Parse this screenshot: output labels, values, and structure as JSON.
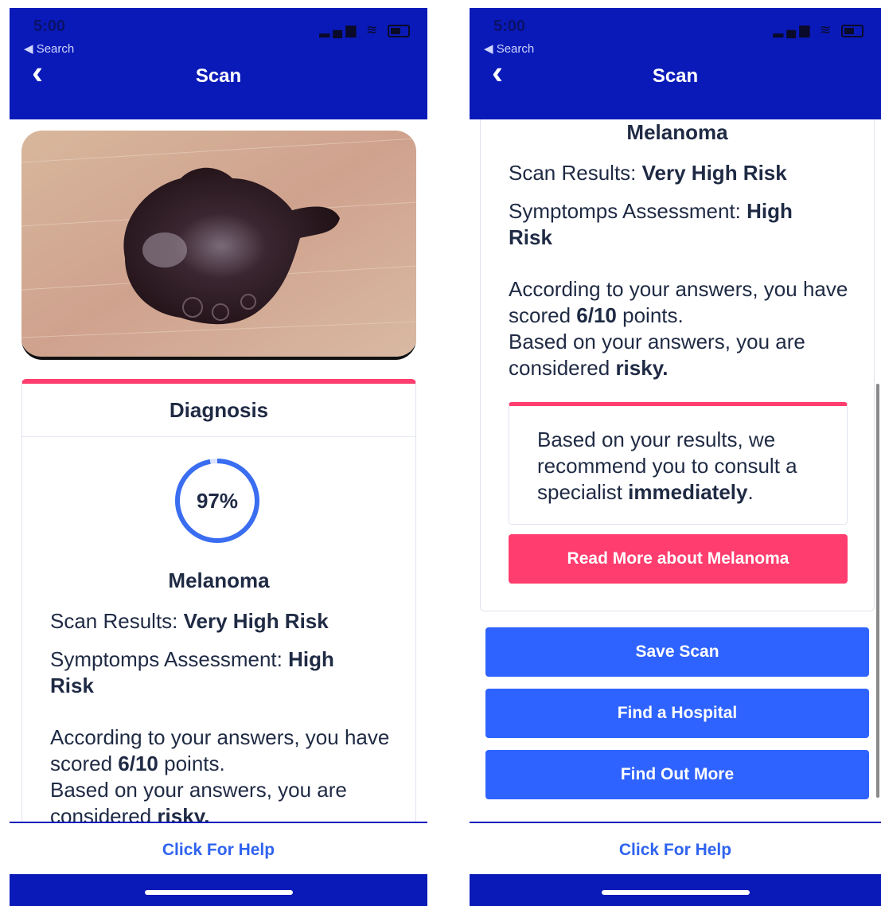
{
  "status_bar": {
    "time": "5:00",
    "back_app": "◀ Search"
  },
  "nav": {
    "title": "Scan",
    "back_icon": "chevron-left-icon"
  },
  "diagnosis": {
    "card_title": "Diagnosis",
    "confidence": "97%",
    "confidence_value": 97,
    "name": "Melanoma",
    "scan_results_label": "Scan Results:",
    "scan_results_value": "Very High Risk",
    "symptoms_label": "Symptomps Assessment:",
    "symptoms_value_1": "High",
    "symptoms_value_2": "Risk",
    "answers_prefix": "According to your answers, you have scored",
    "score": "6/10",
    "answers_suffix": "points.",
    "based_prefix": "Based on your answers, you are considered",
    "risk_word": "risky."
  },
  "recommendation": {
    "prefix": "Based on your results, we recommend you to consult a specialist",
    "emphasis": "immediately",
    "suffix": "."
  },
  "buttons": {
    "read_more": "Read More about Melanoma",
    "save_scan": "Save Scan",
    "find_hospital": "Find a Hospital",
    "find_out_more": "Find Out More"
  },
  "footer": {
    "help": "Click For Help"
  },
  "colors": {
    "header": "#0a1ab8",
    "accent_pink": "#ff3d6e",
    "button_blue": "#2f63ff",
    "link_blue": "#2f63f0"
  }
}
